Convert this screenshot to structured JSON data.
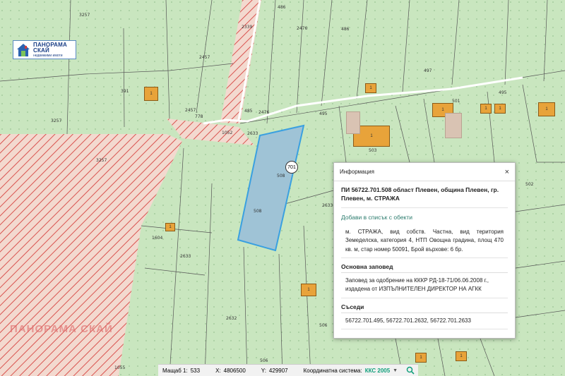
{
  "logo": {
    "name": "ПАНОРАМА СКАЙ",
    "subtitle": "недвижими имоти"
  },
  "watermark": "ПАНОРАМА СКАЙ",
  "selected_plot_badge": "701",
  "plot_labels": [
    "3257",
    "2339",
    "486",
    "2476",
    "486",
    "2457",
    "497",
    "495",
    "501",
    "391",
    "3257",
    "2457",
    "778",
    "485",
    "2476",
    "495",
    "1052",
    "2633",
    "508",
    "508",
    "1",
    "1",
    "1",
    "1",
    "1",
    "1",
    "503",
    "2633",
    "1",
    "3257",
    "2633",
    "2632",
    "506",
    "1604",
    "1055",
    "506",
    "502"
  ],
  "info_panel": {
    "title": "Информация",
    "close_label": "×",
    "parcel_title": "ПИ 56722.701.508 област Плевен, община Плевен, гр. Плевен, м. СТРАЖА",
    "add_link": "Добави в списък с обекти",
    "description": "м. СТРАЖА, вид собств. Частна, вид територия Земеделска, категория 4, НТП Овощна градина, площ 470 кв. м, стар номер 50091, Брой върхове: 6 бр.",
    "order_heading": "Основна заповед",
    "order_text": "Заповед за одобрение на КККР РД-18-71/06.06.2008 г., издадена от ИЗПЪЛНИТЕЛЕН ДИРЕКТОР НА АГКК",
    "neighbors_heading": "Съседи",
    "neighbors_text": "56722.701.495, 56722.701.2632, 56722.701.2633"
  },
  "status_bar": {
    "scale_label": "Мащаб 1:",
    "scale_value": "533",
    "x_label": "X:",
    "x_value": "4806500",
    "y_label": "Y:",
    "y_value": "429907",
    "crs_label": "Координатна система:",
    "crs_value": "ККС 2005",
    "caret": "▼"
  },
  "colors": {
    "map_bg": "#c9e6bf",
    "hatch": "#d9534f",
    "selected_fill": "#9fc3d6",
    "selected_stroke": "#3aa0e0",
    "building": "#e8a33a",
    "accent": "#12a07c"
  }
}
